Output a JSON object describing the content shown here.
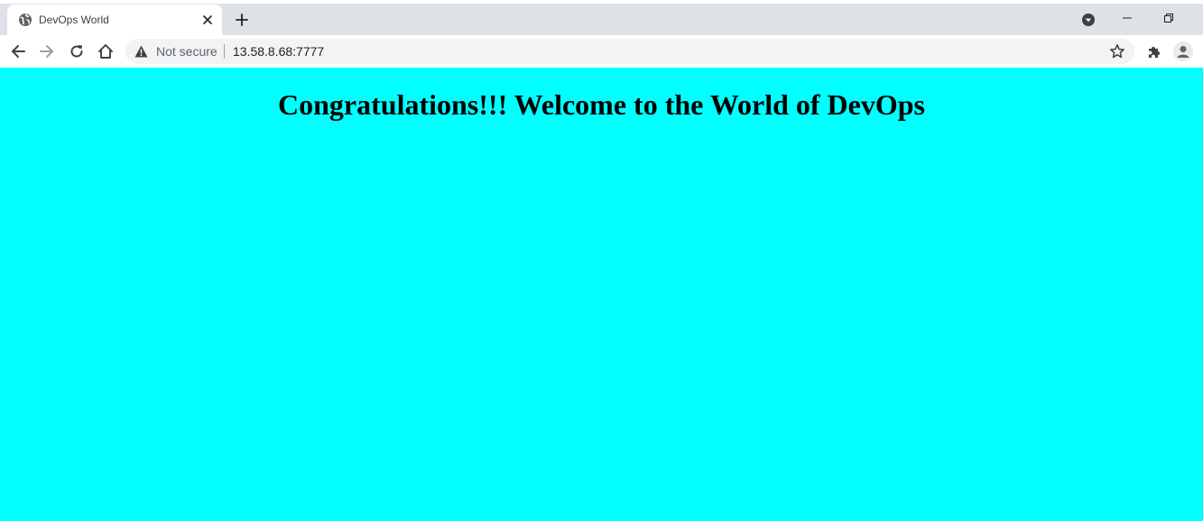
{
  "browser": {
    "tab": {
      "title": "DevOps World",
      "favicon_icon": "globe-icon",
      "close_icon": "close-icon"
    },
    "new_tab_icon": "plus-icon",
    "tab_search_icon": "chevron-down-circle-icon",
    "window_controls": {
      "minimize_icon": "minimize-icon",
      "restore_icon": "restore-icon"
    },
    "toolbar": {
      "back_icon": "arrow-left-icon",
      "forward_icon": "arrow-right-icon",
      "reload_icon": "reload-icon",
      "home_icon": "home-icon",
      "security_icon": "warning-triangle-icon",
      "security_label": "Not secure",
      "url": "13.58.8.68:7777",
      "bookmark_icon": "star-icon",
      "extensions_icon": "puzzle-icon",
      "profile_icon": "avatar-icon"
    }
  },
  "page": {
    "background": "#00ffff",
    "heading": "Congratulations!!! Welcome to the World of DevOps"
  }
}
